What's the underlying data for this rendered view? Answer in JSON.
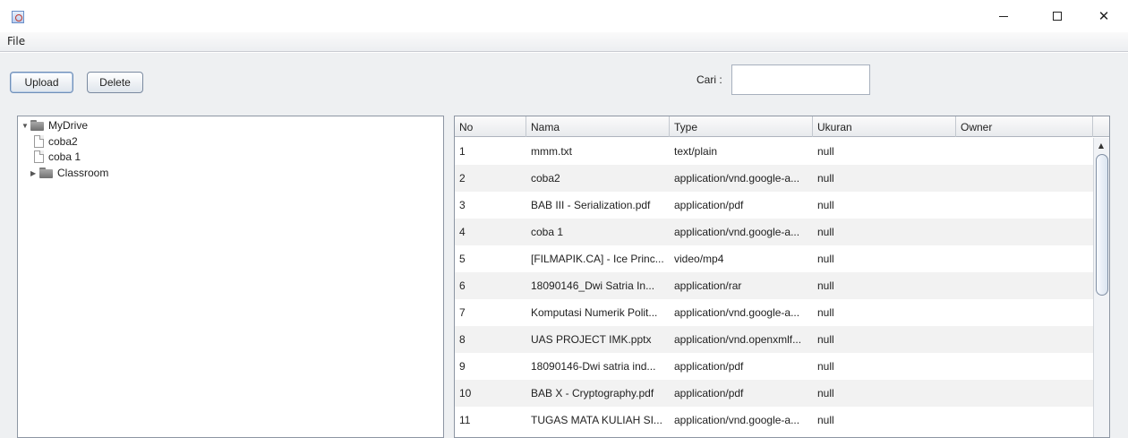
{
  "window": {
    "icon": "java-cup-icon",
    "controls": {
      "minimize": "—",
      "maximize": "☐",
      "close": "✕"
    }
  },
  "menu": {
    "file": "File"
  },
  "toolbar": {
    "upload": "Upload",
    "delete": "Delete",
    "search_label": "Cari :",
    "search_value": ""
  },
  "tree": {
    "root": "MyDrive",
    "items": [
      {
        "label": "coba2",
        "kind": "file"
      },
      {
        "label": "coba 1",
        "kind": "file"
      },
      {
        "label": "Classroom",
        "kind": "folder"
      }
    ]
  },
  "table": {
    "columns": [
      "No",
      "Nama",
      "Type",
      "Ukuran",
      "Owner"
    ],
    "rows": [
      [
        "1",
        "mmm.txt",
        "text/plain",
        "null",
        ""
      ],
      [
        "2",
        "coba2",
        "application/vnd.google-a...",
        "null",
        ""
      ],
      [
        "3",
        "BAB III - Serialization.pdf",
        "application/pdf",
        "null",
        ""
      ],
      [
        "4",
        "coba 1",
        "application/vnd.google-a...",
        "null",
        ""
      ],
      [
        "5",
        "[FILMAPIK.CA] - Ice Princ...",
        "video/mp4",
        "null",
        ""
      ],
      [
        "6",
        "18090146_Dwi Satria In...",
        "application/rar",
        "null",
        ""
      ],
      [
        "7",
        "Komputasi Numerik Polit...",
        "application/vnd.google-a...",
        "null",
        ""
      ],
      [
        "8",
        "UAS PROJECT IMK.pptx",
        "application/vnd.openxmlf...",
        "null",
        ""
      ],
      [
        "9",
        "18090146-Dwi satria ind...",
        "application/pdf",
        "null",
        ""
      ],
      [
        "10",
        "BAB X - Cryptography.pdf",
        "application/pdf",
        "null",
        ""
      ],
      [
        "11",
        "TUGAS MATA KULIAH SI...",
        "application/vnd.google-a...",
        "null",
        ""
      ]
    ]
  }
}
